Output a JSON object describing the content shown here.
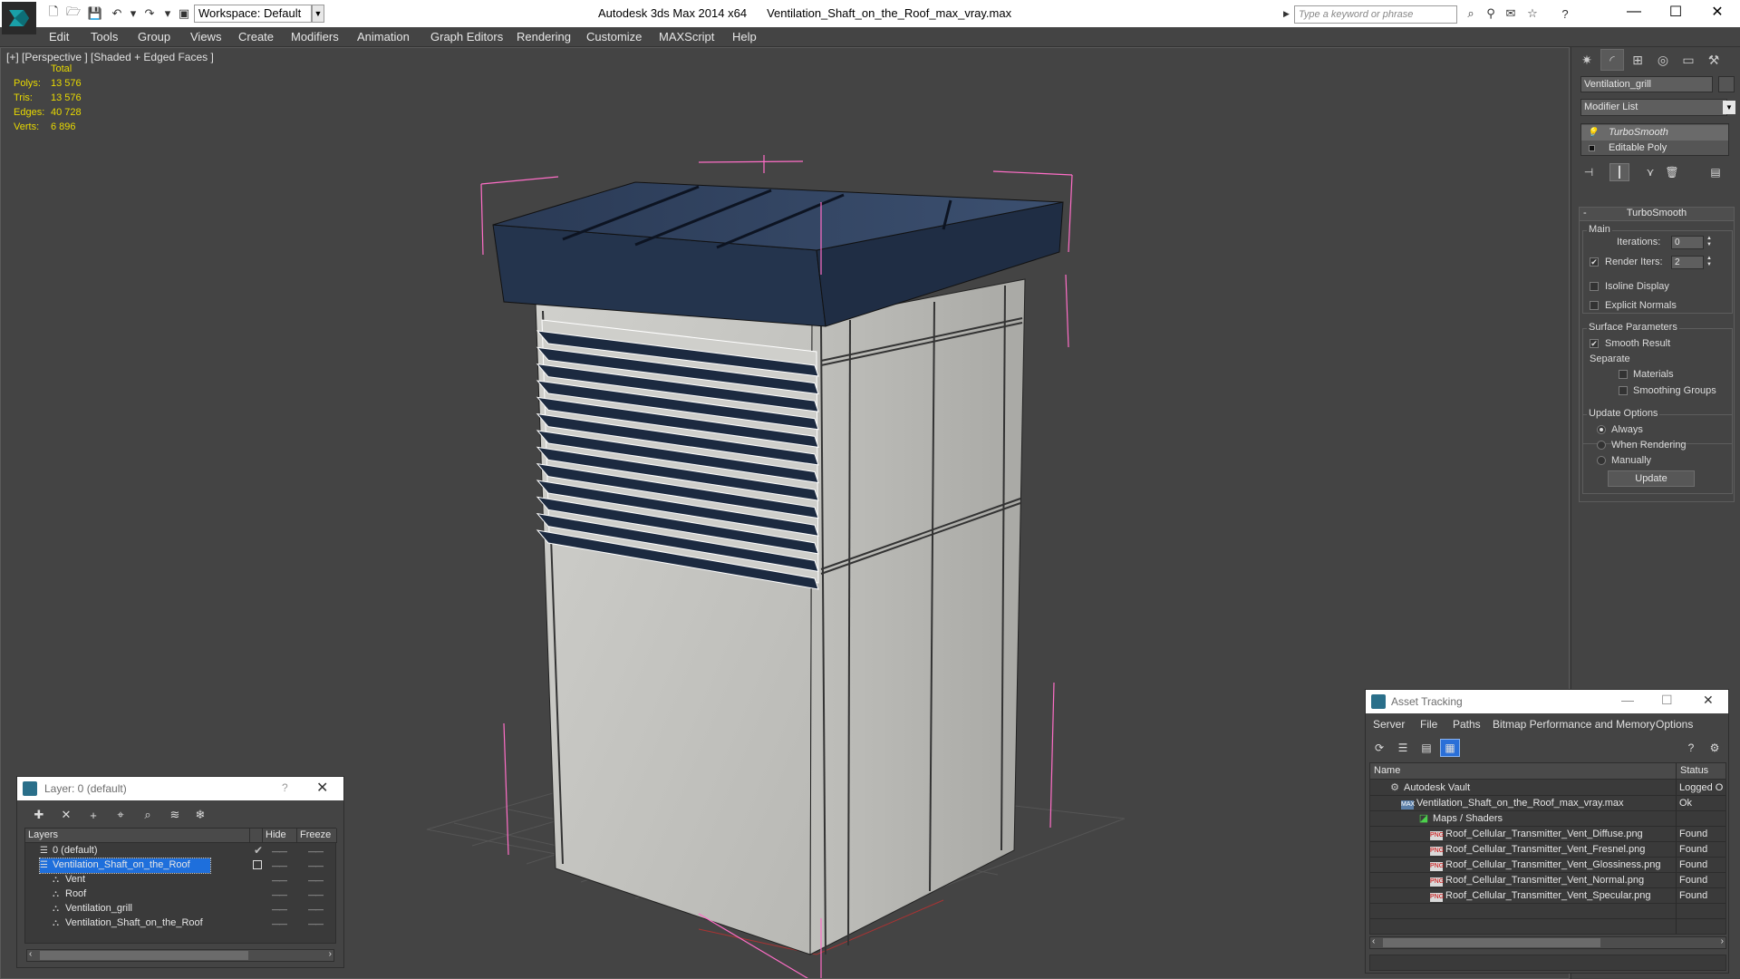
{
  "titlebar": {
    "workspace": "Workspace: Default",
    "app_name": "Autodesk 3ds Max  2014 x64",
    "file_name": "Ventilation_Shaft_on_the_Roof_max_vray.max",
    "search_placeholder": "Type a keyword or phrase"
  },
  "menu": [
    "Edit",
    "Tools",
    "Group",
    "Views",
    "Create",
    "Modifiers",
    "Animation",
    "Graph Editors",
    "Rendering",
    "Customize",
    "MAXScript",
    "Help"
  ],
  "viewport": {
    "label": "[+] [Perspective ] [Shaded + Edged Faces ]",
    "stats_header": "Total",
    "stats": [
      {
        "key": "Polys:",
        "value": "13 576"
      },
      {
        "key": "Tris:",
        "value": "13 576"
      },
      {
        "key": "Edges:",
        "value": "40 728"
      },
      {
        "key": "Verts:",
        "value": "6 896"
      }
    ]
  },
  "command_panel": {
    "object_name": "Ventilation_grill",
    "modifier_list": "Modifier List",
    "stack": [
      "TurboSmooth",
      "Editable Poly"
    ],
    "rollout_title": "TurboSmooth",
    "main_group": "Main",
    "iterations_label": "Iterations:",
    "iterations_value": "0",
    "render_iters_label": "Render Iters:",
    "render_iters_value": "2",
    "isoline_label": "Isoline Display",
    "explicit_normals_label": "Explicit Normals",
    "surface_group": "Surface Parameters",
    "smooth_result_label": "Smooth Result",
    "separate_label": "Separate",
    "materials_label": "Materials",
    "smoothing_groups_label": "Smoothing Groups",
    "update_group": "Update Options",
    "always_label": "Always",
    "when_rendering_label": "When Rendering",
    "manually_label": "Manually",
    "update_button": "Update"
  },
  "layer_dialog": {
    "title": "Layer: 0 (default)",
    "help": "?",
    "col_layers": "Layers",
    "col_hide": "Hide",
    "col_freeze": "Freeze",
    "rows": [
      {
        "name": "0 (default)",
        "indent": 0
      },
      {
        "name": "Ventilation_Shaft_on_the_Roof",
        "indent": 0
      },
      {
        "name": "Vent",
        "indent": 1
      },
      {
        "name": "Roof",
        "indent": 1
      },
      {
        "name": "Ventilation_grill",
        "indent": 1
      },
      {
        "name": "Ventilation_Shaft_on_the_Roof",
        "indent": 1
      }
    ]
  },
  "asset_dialog": {
    "title": "Asset Tracking",
    "menu": [
      "Server",
      "File",
      "Paths",
      "Bitmap Performance and Memory",
      "Options"
    ],
    "col_name": "Name",
    "col_status": "Status",
    "rows": [
      {
        "name": "Autodesk Vault",
        "status": "Logged O",
        "icon": "vault-icon"
      },
      {
        "name": "Ventilation_Shaft_on_the_Roof_max_vray.max",
        "status": "Ok",
        "icon": "max-file-icon"
      },
      {
        "name": "Maps / Shaders",
        "status": "",
        "icon": "maps-icon"
      },
      {
        "name": "Roof_Cellular_Transmitter_Vent_Diffuse.png",
        "status": "Found",
        "icon": "png-icon"
      },
      {
        "name": "Roof_Cellular_Transmitter_Vent_Fresnel.png",
        "status": "Found",
        "icon": "png-icon"
      },
      {
        "name": "Roof_Cellular_Transmitter_Vent_Glossiness.png",
        "status": "Found",
        "icon": "png-icon"
      },
      {
        "name": "Roof_Cellular_Transmitter_Vent_Normal.png",
        "status": "Found",
        "icon": "png-icon"
      },
      {
        "name": "Roof_Cellular_Transmitter_Vent_Specular.png",
        "status": "Found",
        "icon": "png-icon"
      }
    ]
  },
  "colors": {
    "ui_bg": "#444444",
    "stats_yellow": "#e8d900",
    "selection_blue": "#1e6fdc",
    "bbox_pink": "#ff6ec7"
  }
}
